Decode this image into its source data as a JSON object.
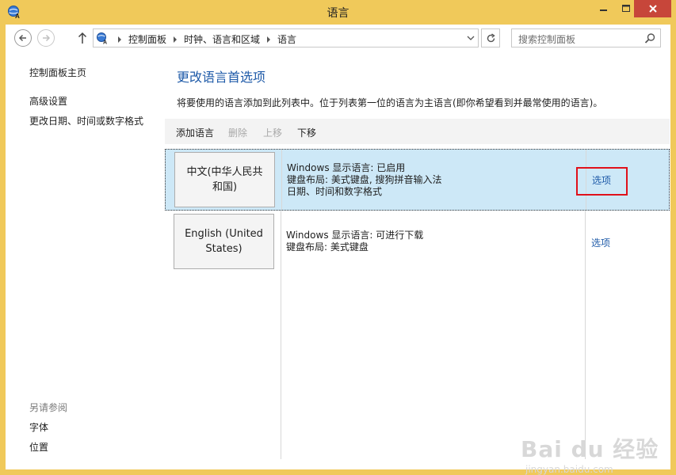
{
  "window": {
    "title": "语言",
    "accent": "#f0c95a",
    "close_color": "#c7463a"
  },
  "address": {
    "breadcrumbs": [
      "控制面板",
      "时钟、语言和区域",
      "语言"
    ],
    "search_placeholder": "搜索控制面板"
  },
  "sidebar": {
    "home": "控制面板主页",
    "links": [
      "高级设置",
      "更改日期、时间或数字格式"
    ],
    "see_also_title": "另请参阅",
    "see_also": [
      "字体",
      "位置"
    ]
  },
  "main": {
    "heading": "更改语言首选项",
    "description": "将要使用的语言添加到此列表中。位于列表第一位的语言为主语言(即你希望看到并最常使用的语言)。",
    "toolbar": {
      "add": "添加语言",
      "remove": "删除",
      "up": "上移",
      "down": "下移"
    },
    "languages": [
      {
        "name_line1": "中文(中华人民共",
        "name_line2": "和国)",
        "info": [
          "Windows 显示语言: 已启用",
          "键盘布局: 美式键盘, 搜狗拼音输入法",
          "日期、时间和数字格式"
        ],
        "options": "选项"
      },
      {
        "name_line1": "English (United",
        "name_line2": "States)",
        "info": [
          "Windows 显示语言: 可进行下载",
          "键盘布局: 美式键盘"
        ],
        "options": "选项"
      }
    ]
  },
  "watermark": {
    "brand": "Bai du 经验",
    "url": "jingyan.baidu.com"
  },
  "colors": {
    "link_blue": "#1e5aa8",
    "selection": "#cde8f7",
    "highlight_red": "#e0101a"
  }
}
